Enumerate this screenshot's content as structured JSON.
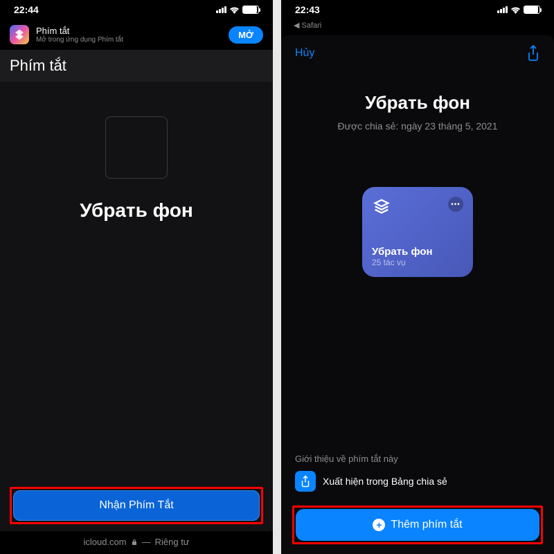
{
  "status": {
    "time": "22:44",
    "time2": "22:43"
  },
  "left": {
    "banner": {
      "title": "Phím tắt",
      "subtitle": "Mở trong ứng dụng Phím tắt",
      "open": "MỞ"
    },
    "pageTitle": "Phím tắt",
    "mainTitle": "Убрать фон",
    "getButton": "Nhận Phím Tắt",
    "urlDomain": "icloud.com",
    "urlPrivacy": "Riêng tư"
  },
  "right": {
    "back": "Safari",
    "cancel": "Hủy",
    "title": "Убрать фон",
    "subtitle": "Được chia sẻ: ngày 23 tháng 5, 2021",
    "card": {
      "title": "Убрать фон",
      "subtitle": "25 tác vụ"
    },
    "info": {
      "heading": "Giới thiệu về phím tắt này",
      "row1": "Xuất hiện trong Bảng chia sẻ"
    },
    "addButton": "Thêm phím tắt"
  }
}
